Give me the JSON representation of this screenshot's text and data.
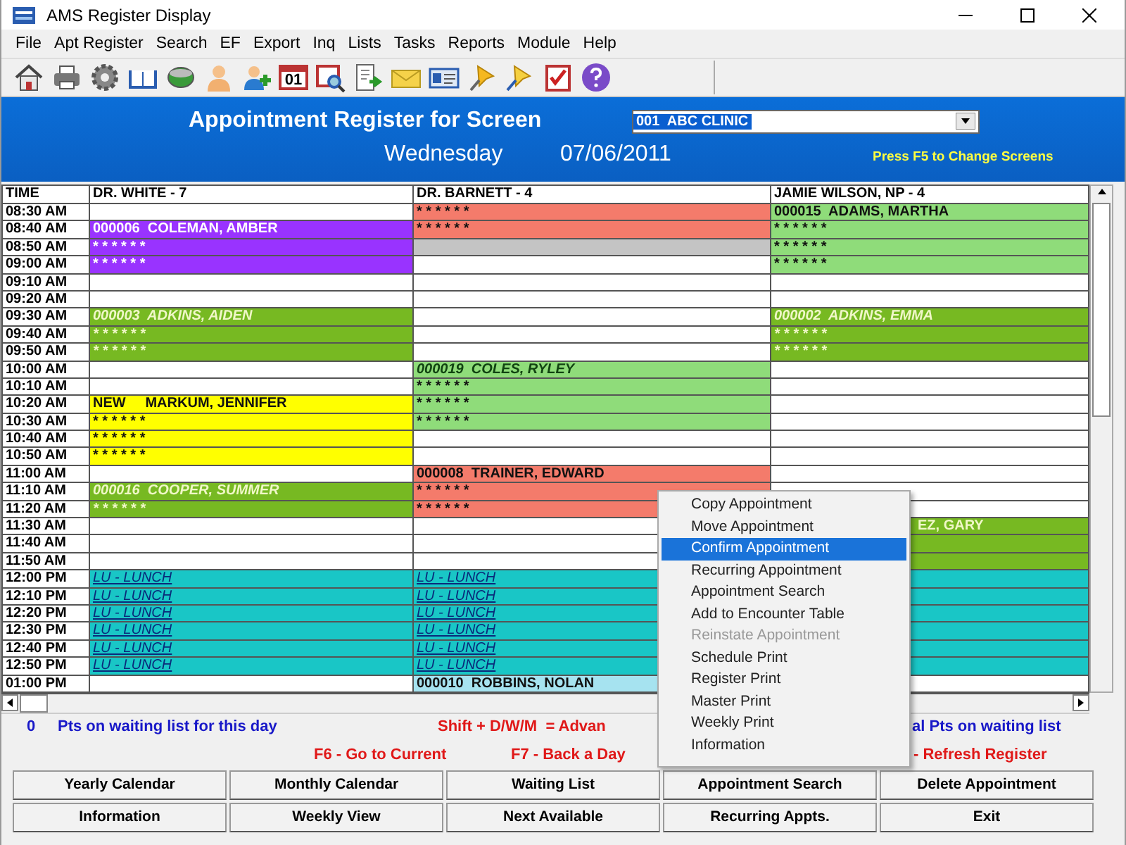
{
  "window": {
    "title": "AMS Register Display"
  },
  "menu": [
    "File",
    "Apt Register",
    "Search",
    "EF",
    "Export",
    "Inq",
    "Lists",
    "Tasks",
    "Reports",
    "Module",
    "Help"
  ],
  "toolbar": [
    {
      "kind": "home"
    },
    {
      "kind": "printer"
    },
    {
      "kind": "gear"
    },
    {
      "kind": "book"
    },
    {
      "kind": "drive"
    },
    {
      "kind": "person"
    },
    {
      "kind": "person-add"
    },
    {
      "kind": "calendar",
      "label": "01"
    },
    {
      "kind": "calendar-search"
    },
    {
      "kind": "document-arrow"
    },
    {
      "kind": "envelope"
    },
    {
      "kind": "id-card"
    },
    {
      "kind": "pin"
    },
    {
      "kind": "pin-pointer"
    },
    {
      "kind": "checklist"
    },
    {
      "kind": "help"
    }
  ],
  "header": {
    "title": "Appointment Register for Screen",
    "screen": "001  ABC CLINIC",
    "day": "Wednesday",
    "date": "07/06/2011",
    "hint": "Press F5 to Change Screens"
  },
  "columns": [
    "TIME",
    "DR. WHITE - 7",
    "DR. BARNETT - 4",
    "JAMIE WILSON, NP - 4"
  ],
  "rows": [
    {
      "time": "08:30 AM",
      "cells": [
        {},
        {
          "text": "* * * * * *",
          "color": "#f47b6b",
          "kind": "plain"
        },
        {
          "text": "000015  ADAMS, MARTHA",
          "color": "#8fdc7a",
          "kind": "plain"
        }
      ]
    },
    {
      "time": "08:40 AM",
      "cells": [
        {
          "text": "000006  COLEMAN, AMBER",
          "color": "#9933ff",
          "kind": "light"
        },
        {
          "text": "* * * * * *",
          "color": "#f47b6b",
          "kind": "plain"
        },
        {
          "text": "* * * * * *",
          "color": "#8fdc7a",
          "kind": "plain"
        }
      ]
    },
    {
      "time": "08:50 AM",
      "cells": [
        {
          "text": "* * * * * *",
          "color": "#9933ff",
          "kind": "light"
        },
        {
          "color": "#c4c4c4"
        },
        {
          "text": "* * * * * *",
          "color": "#8fdc7a",
          "kind": "plain"
        }
      ]
    },
    {
      "time": "09:00 AM",
      "cells": [
        {
          "text": "* * * * * *",
          "color": "#9933ff",
          "kind": "light"
        },
        {},
        {
          "text": "* * * * * *",
          "color": "#8fdc7a",
          "kind": "plain"
        }
      ]
    },
    {
      "time": "09:10 AM",
      "cells": [
        {},
        {},
        {}
      ]
    },
    {
      "time": "09:20 AM",
      "cells": [
        {},
        {},
        {}
      ]
    },
    {
      "time": "09:30 AM",
      "cells": [
        {
          "text": "000003  ADKINS, AIDEN",
          "color": "#77b922",
          "kind": "faint"
        },
        {},
        {
          "text": "000002  ADKINS, EMMA",
          "color": "#77b922",
          "kind": "faint"
        }
      ]
    },
    {
      "time": "09:40 AM",
      "cells": [
        {
          "text": "* * * * * *",
          "color": "#77b922",
          "kind": "faint"
        },
        {},
        {
          "text": "* * * * * *",
          "color": "#77b922",
          "kind": "faint"
        }
      ]
    },
    {
      "time": "09:50 AM",
      "cells": [
        {
          "text": "* * * * * *",
          "color": "#77b922",
          "kind": "faint"
        },
        {},
        {
          "text": "* * * * * *",
          "color": "#77b922",
          "kind": "faint"
        }
      ]
    },
    {
      "time": "10:00 AM",
      "cells": [
        {},
        {
          "text": "000019  COLES, RYLEY",
          "color": "#8fdc7a",
          "kind": "italic"
        },
        {}
      ]
    },
    {
      "time": "10:10 AM",
      "cells": [
        {},
        {
          "text": "* * * * * *",
          "color": "#8fdc7a",
          "kind": "plain"
        },
        {}
      ]
    },
    {
      "time": "10:20 AM",
      "cells": [
        {
          "text": "NEW     MARKUM, JENNIFER",
          "color": "#ffff00",
          "kind": "plain"
        },
        {
          "text": "* * * * * *",
          "color": "#8fdc7a",
          "kind": "plain"
        },
        {}
      ]
    },
    {
      "time": "10:30 AM",
      "cells": [
        {
          "text": "* * * * * *",
          "color": "#ffff00",
          "kind": "plain"
        },
        {
          "text": "* * * * * *",
          "color": "#8fdc7a",
          "kind": "plain"
        },
        {}
      ]
    },
    {
      "time": "10:40 AM",
      "cells": [
        {
          "text": "* * * * * *",
          "color": "#ffff00",
          "kind": "plain"
        },
        {},
        {}
      ]
    },
    {
      "time": "10:50 AM",
      "cells": [
        {
          "text": "* * * * * *",
          "color": "#ffff00",
          "kind": "plain"
        },
        {},
        {}
      ]
    },
    {
      "time": "11:00 AM",
      "cells": [
        {},
        {
          "text": "000008  TRAINER, EDWARD",
          "color": "#f47b6b",
          "kind": "plain"
        },
        {}
      ]
    },
    {
      "time": "11:10 AM",
      "cells": [
        {
          "text": "000016  COOPER, SUMMER",
          "color": "#77b922",
          "kind": "faint"
        },
        {
          "text": "* * * * * *",
          "color": "#f47b6b",
          "kind": "plain"
        },
        {}
      ]
    },
    {
      "time": "11:20 AM",
      "cells": [
        {
          "text": "* * * * * *",
          "color": "#77b922",
          "kind": "faint"
        },
        {
          "text": "* * * * * *",
          "color": "#f47b6b",
          "kind": "plain"
        },
        {}
      ]
    },
    {
      "time": "11:30 AM",
      "cells": [
        {},
        {},
        {
          "text": "EZ, GARY",
          "color": "#77b922",
          "kind": "covered"
        }
      ]
    },
    {
      "time": "11:40 AM",
      "cells": [
        {},
        {},
        {
          "color": "#77b922"
        }
      ]
    },
    {
      "time": "11:50 AM",
      "cells": [
        {},
        {},
        {
          "color": "#77b922"
        }
      ]
    },
    {
      "time": "12:00 PM",
      "cells": [
        {
          "text": "LU - LUNCH",
          "color": "#19c6c6",
          "kind": "lunch"
        },
        {
          "text": "LU - LUNCH",
          "color": "#19c6c6",
          "kind": "lunch"
        },
        {
          "color": "#19c6c6"
        }
      ]
    },
    {
      "time": "12:10 PM",
      "cells": [
        {
          "text": "LU - LUNCH",
          "color": "#19c6c6",
          "kind": "lunch"
        },
        {
          "text": "LU - LUNCH",
          "color": "#19c6c6",
          "kind": "lunch"
        },
        {
          "color": "#19c6c6"
        }
      ]
    },
    {
      "time": "12:20 PM",
      "cells": [
        {
          "text": "LU - LUNCH",
          "color": "#19c6c6",
          "kind": "lunch"
        },
        {
          "text": "LU - LUNCH",
          "color": "#19c6c6",
          "kind": "lunch"
        },
        {
          "color": "#19c6c6"
        }
      ]
    },
    {
      "time": "12:30 PM",
      "cells": [
        {
          "text": "LU - LUNCH",
          "color": "#19c6c6",
          "kind": "lunch"
        },
        {
          "text": "LU - LUNCH",
          "color": "#19c6c6",
          "kind": "lunch"
        },
        {
          "color": "#19c6c6"
        }
      ]
    },
    {
      "time": "12:40 PM",
      "cells": [
        {
          "text": "LU - LUNCH",
          "color": "#19c6c6",
          "kind": "lunch"
        },
        {
          "text": "LU - LUNCH",
          "color": "#19c6c6",
          "kind": "lunch"
        },
        {
          "color": "#19c6c6"
        }
      ]
    },
    {
      "time": "12:50 PM",
      "cells": [
        {
          "text": "LU - LUNCH",
          "color": "#19c6c6",
          "kind": "lunch"
        },
        {
          "text": "LU - LUNCH",
          "color": "#19c6c6",
          "kind": "lunch"
        },
        {
          "color": "#19c6c6"
        }
      ]
    },
    {
      "time": "01:00 PM",
      "cells": [
        {},
        {
          "text": "000010  ROBBINS, NOLAN",
          "color": "#a6e3f0",
          "kind": "plain"
        },
        {}
      ]
    }
  ],
  "status": {
    "waiting_count": "0",
    "waiting_text": "Pts on waiting list for this day",
    "shift_hint": "Shift + D/W/M  = Advan",
    "total_hint": "al Pts on waiting list",
    "f6_hint": "F6 - Go to Current",
    "f7_hint": "F7 - Back a Day",
    "refresh_hint": "- Refresh Register"
  },
  "buttons": [
    "Yearly Calendar",
    "Monthly Calendar",
    "Waiting List",
    "Appointment Search",
    "Delete Appointment",
    "Information",
    "Weekly View",
    "Next Available",
    "Recurring Appts.",
    "Exit"
  ],
  "context_menu": [
    {
      "label": "Copy Appointment",
      "selected": false,
      "disabled": false
    },
    {
      "label": "Move Appointment",
      "selected": false,
      "disabled": false
    },
    {
      "label": "Confirm Appointment",
      "selected": true,
      "disabled": false
    },
    {
      "label": "Recurring Appointment",
      "selected": false,
      "disabled": false
    },
    {
      "label": "Appointment Search",
      "selected": false,
      "disabled": false
    },
    {
      "label": "Add to Encounter Table",
      "selected": false,
      "disabled": false
    },
    {
      "label": "Reinstate Appointment",
      "selected": false,
      "disabled": true
    },
    {
      "label": "Schedule Print",
      "selected": false,
      "disabled": false
    },
    {
      "label": "Register Print",
      "selected": false,
      "disabled": false
    },
    {
      "label": "Master Print",
      "selected": false,
      "disabled": false
    },
    {
      "label": "Weekly Print",
      "selected": false,
      "disabled": false
    },
    {
      "label": "Information",
      "selected": false,
      "disabled": false
    }
  ]
}
